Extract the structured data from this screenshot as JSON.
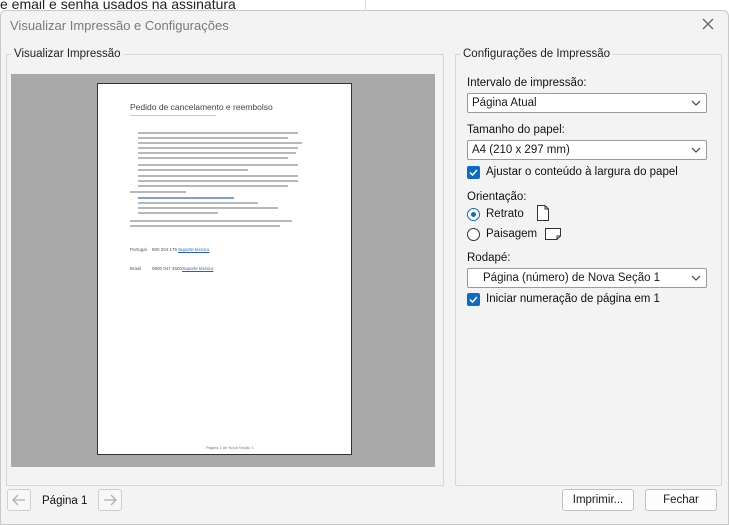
{
  "background": {
    "text": "e email e senha usados na assinatura"
  },
  "dialog": {
    "title": "Visualizar Impressão e Configurações"
  },
  "preview": {
    "legend": "Visualizar Impressão",
    "page": {
      "title": "Pedido de cancelamento e reembolso",
      "portugal_label": "Portugal",
      "portugal_phone": "800 204 175",
      "portugal_link": "Suporte técnico",
      "brasil_label": "Brasil",
      "brasil_phone": "0800 047 4500",
      "brasil_link": "Suporte técnico",
      "footer": "Página 1 de Nova Seção 1"
    }
  },
  "settings": {
    "legend": "Configurações de Impressão",
    "range_label": "Intervalo de impressão:",
    "range_value": "Página Atual",
    "paper_label": "Tamanho do papel:",
    "paper_value": "A4 (210 x 297 mm)",
    "fit_width_label": "Ajustar o conteúdo à largura do papel",
    "orientation_label": "Orientação:",
    "portrait_label": "Retrato",
    "landscape_label": "Paisagem",
    "footer_label": "Rodapé:",
    "footer_value": "Página (número) de Nova Seção 1",
    "start_numbering_label": "Iniciar numeração de página em 1"
  },
  "bottom": {
    "page_indicator": "Página 1",
    "print_button": "Imprimir...",
    "close_button": "Fechar"
  },
  "colors": {
    "accent": "#0a6bc8",
    "preview_bg": "#a9a9a9",
    "dialog_bg": "#f3f3f3"
  }
}
